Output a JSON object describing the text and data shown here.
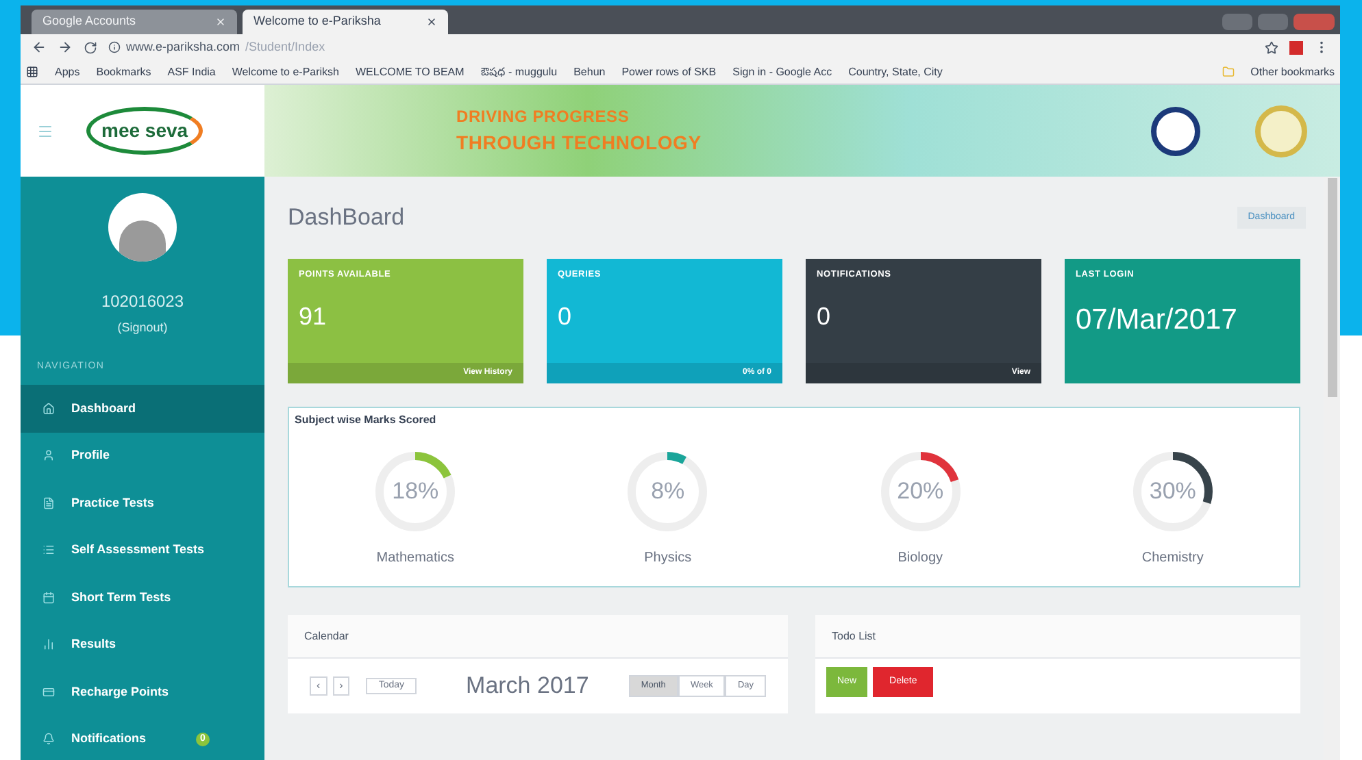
{
  "browser": {
    "tabs": [
      {
        "label": "Google Accounts",
        "selected": false
      },
      {
        "label": "Welcome to e-Pariksha",
        "selected": true
      }
    ],
    "url": {
      "host": "www.e-pariksha.com",
      "path": "/Student/Index"
    },
    "bookmarks": [
      "Apps",
      "Bookmarks",
      "ASF India",
      "Welcome to e-Pariksh",
      "WELCOME TO BEAM",
      "ఔషధ - muggulu",
      "Behun",
      "Power rows of SKB",
      "Sign in - Google Acc",
      "Country, State, City"
    ],
    "other_bookmarks": "Other bookmarks"
  },
  "header": {
    "logo": "mee seva",
    "tagline_1": "DRIVING PROGRESS",
    "tagline_2": "THROUGH TECHNOLOGY"
  },
  "sidebar": {
    "user_id": "102016023",
    "signout": "(Signout)",
    "section": "NAVIGATION",
    "items": [
      {
        "label": "Dashboard",
        "selected": true
      },
      {
        "label": "Profile",
        "selected": false
      },
      {
        "label": "Practice Tests",
        "selected": false
      },
      {
        "label": "Self Assessment Tests",
        "selected": false
      },
      {
        "label": "Short Term Tests",
        "selected": false
      },
      {
        "label": "Results",
        "selected": false
      },
      {
        "label": "Recharge Points",
        "selected": false
      },
      {
        "label": "Notifications",
        "selected": false,
        "badge": "0"
      }
    ]
  },
  "page": {
    "title": "DashBoard",
    "breadcrumb": "Dashboard"
  },
  "stats": [
    {
      "label": "POINTS AVAILABLE",
      "value": "91",
      "footer": "View History",
      "color": "#8cc043"
    },
    {
      "label": "QUERIES",
      "value": "0",
      "footer": "0% of 0",
      "color": "#12b8d4"
    },
    {
      "label": "NOTIFICATIONS",
      "value": "0",
      "footer": "View",
      "color": "#343e46"
    },
    {
      "label": "LAST LOGIN",
      "value": "07/Mar/2017",
      "color": "#129a86"
    }
  ],
  "marks": {
    "title": "Subject wise Marks Scored",
    "subjects": [
      {
        "name": "Mathematics",
        "reading": "18%",
        "level": 0.18,
        "color": "#8cc43c"
      },
      {
        "name": "Physics",
        "reading": "8%",
        "level": 0.08,
        "color": "#1aa59a"
      },
      {
        "name": "Biology",
        "reading": "20%",
        "level": 0.2,
        "color": "#e0333c"
      },
      {
        "name": "Chemistry",
        "reading": "30%",
        "level": 0.3,
        "color": "#37434a"
      }
    ]
  },
  "calendar": {
    "title": "Calendar",
    "prev": "‹",
    "next": "›",
    "today": "Today",
    "month": "March 2017",
    "views": [
      {
        "label": "Month",
        "selected": true
      },
      {
        "label": "Week",
        "selected": false
      },
      {
        "label": "Day",
        "selected": false
      }
    ]
  },
  "todo": {
    "title": "Todo List",
    "buttons": [
      {
        "label": "New",
        "kind": "add"
      },
      {
        "label": "Delete",
        "kind": "delete"
      }
    ]
  }
}
